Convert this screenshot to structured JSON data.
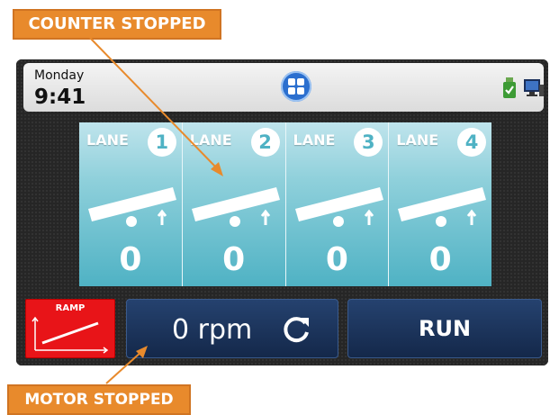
{
  "callouts": {
    "counter_stopped": "COUNTER STOPPED",
    "motor_stopped": "MOTOR STOPPED"
  },
  "header": {
    "day": "Monday",
    "time": "9:41",
    "home_icon": "grid-icon",
    "usb_icon": "usb-check-icon",
    "pc_icon": "computer-icon"
  },
  "lanes": [
    {
      "label": "LANE",
      "number": "1",
      "count": "0"
    },
    {
      "label": "LANE",
      "number": "2",
      "count": "0"
    },
    {
      "label": "LANE",
      "number": "3",
      "count": "0"
    },
    {
      "label": "LANE",
      "number": "4",
      "count": "0"
    }
  ],
  "controls": {
    "ramp_label": "RAMP",
    "rpm": "0 rpm",
    "run": "RUN"
  },
  "colors": {
    "callout": "#e88a2c",
    "lane_gradient_top": "#bfe4ec",
    "lane_gradient_bottom": "#4fb2c4",
    "ramp_red": "#e81418",
    "button_navy": "#1c355d",
    "home_blue": "#2b6fcf"
  }
}
